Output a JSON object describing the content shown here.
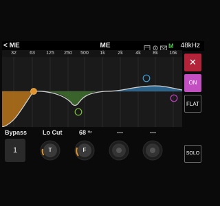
{
  "header": {
    "back_label": "< ME",
    "title": "ME",
    "icons": [
      "window-icon",
      "gear-icon",
      "mail-icon",
      "monitor-m-icon"
    ],
    "monitor_letter": "M",
    "sample_rate": "48kHz"
  },
  "freq_axis": {
    "ticks": [
      "32",
      "63",
      "125",
      "250",
      "500",
      "1k",
      "2k",
      "4k",
      "8k",
      "16k"
    ]
  },
  "eq": {
    "colors": {
      "low_cut_fill": "#b8741a",
      "band1_fill": "#3d6b2e",
      "band3_fill": "#2e6790",
      "curve": "#cfcfcf",
      "node_low": "#e0942e",
      "node_mid": "#7fc13c",
      "node_high": "#3aa0e0",
      "node_air": "#c542c5"
    }
  },
  "side_buttons": {
    "close_label": "✕",
    "on_label": "ON",
    "flat_label": "FLAT",
    "solo_label": "SOLO"
  },
  "controls": {
    "bypass_label": "Bypass",
    "bypass_value": "1",
    "locut_label": "Lo Cut",
    "freq_value": "68",
    "freq_unit": "Hz",
    "dash1": "---",
    "dash2": "---",
    "knobs": [
      {
        "label": "T",
        "active": true
      },
      {
        "label": "F",
        "active": true
      },
      {
        "label": "",
        "active": false
      },
      {
        "label": "",
        "active": false
      }
    ]
  }
}
